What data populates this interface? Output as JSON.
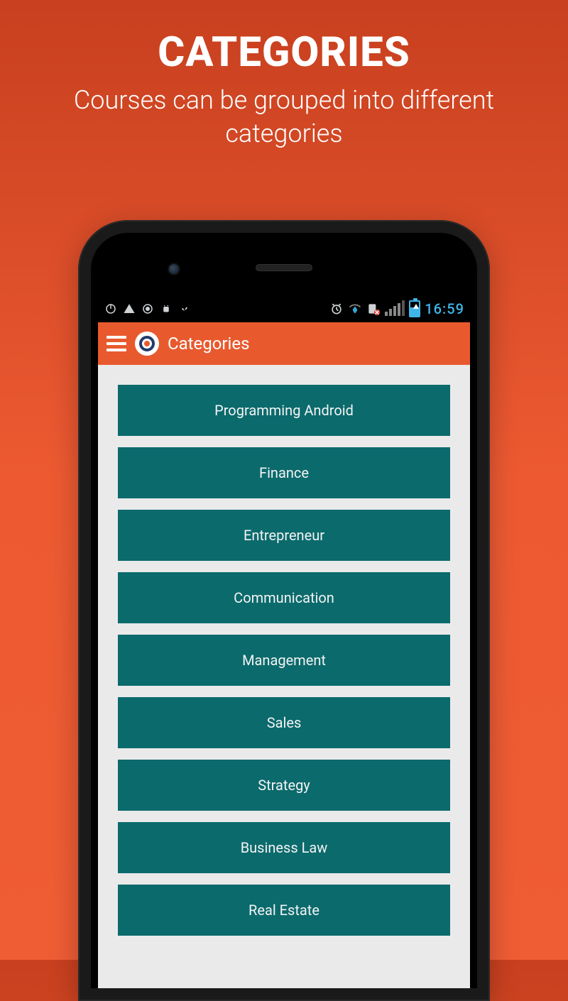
{
  "promo": {
    "title": "CATEGORIES",
    "subtitle": "Courses can be grouped into different categories"
  },
  "status_bar": {
    "time": "16:59"
  },
  "app_bar": {
    "title": "Categories"
  },
  "categories": [
    {
      "label": "Programming Android"
    },
    {
      "label": "Finance"
    },
    {
      "label": "Entrepreneur"
    },
    {
      "label": "Communication"
    },
    {
      "label": "Management"
    },
    {
      "label": "Sales"
    },
    {
      "label": "Strategy"
    },
    {
      "label": "Business Law"
    },
    {
      "label": "Real Estate"
    }
  ],
  "colors": {
    "accent": "#e85a2e",
    "category_bg": "#0b6a6c",
    "status_time": "#3fb6e8"
  }
}
